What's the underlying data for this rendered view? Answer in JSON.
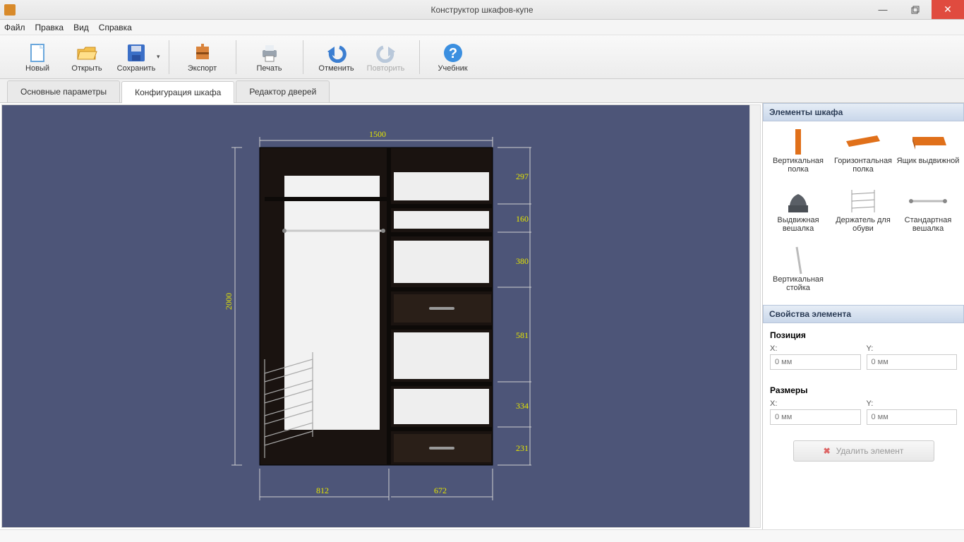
{
  "window": {
    "title": "Конструктор шкафов-купе"
  },
  "menu": {
    "file": "Файл",
    "edit": "Правка",
    "view": "Вид",
    "help": "Справка"
  },
  "toolbar": {
    "new": "Новый",
    "open": "Открыть",
    "save": "Сохранить",
    "export": "Экспорт",
    "print": "Печать",
    "undo": "Отменить",
    "redo": "Повторить",
    "tutorial": "Учебник"
  },
  "tabs": {
    "t0": "Основные параметры",
    "t1": "Конфигурация шкафа",
    "t2": "Редактор дверей"
  },
  "sidebar": {
    "elements_header": "Элементы шкафа",
    "items": {
      "vshelf": "Вертикальная полка",
      "hshelf": "Горизонтальная полка",
      "drawer": "Ящик выдвижной",
      "phanger": "Выдвижная вешалка",
      "shoe": "Держатель для обуви",
      "hanger": "Стандартная вешалка",
      "vpost": "Вертикальная стойка"
    },
    "props_header": "Свойства элемента",
    "position_title": "Позиция",
    "size_title": "Размеры",
    "x_label": "X:",
    "y_label": "Y:",
    "placeholder": "0 мм",
    "delete_btn": "Удалить элемент"
  },
  "wardrobe": {
    "width_total": "1500",
    "height_total": "2000",
    "section_left_w": "812",
    "section_right_w": "672",
    "rows": {
      "r1": "297",
      "r2": "160",
      "r3": "380",
      "r4": "581",
      "r5": "334",
      "r6": "231"
    }
  }
}
